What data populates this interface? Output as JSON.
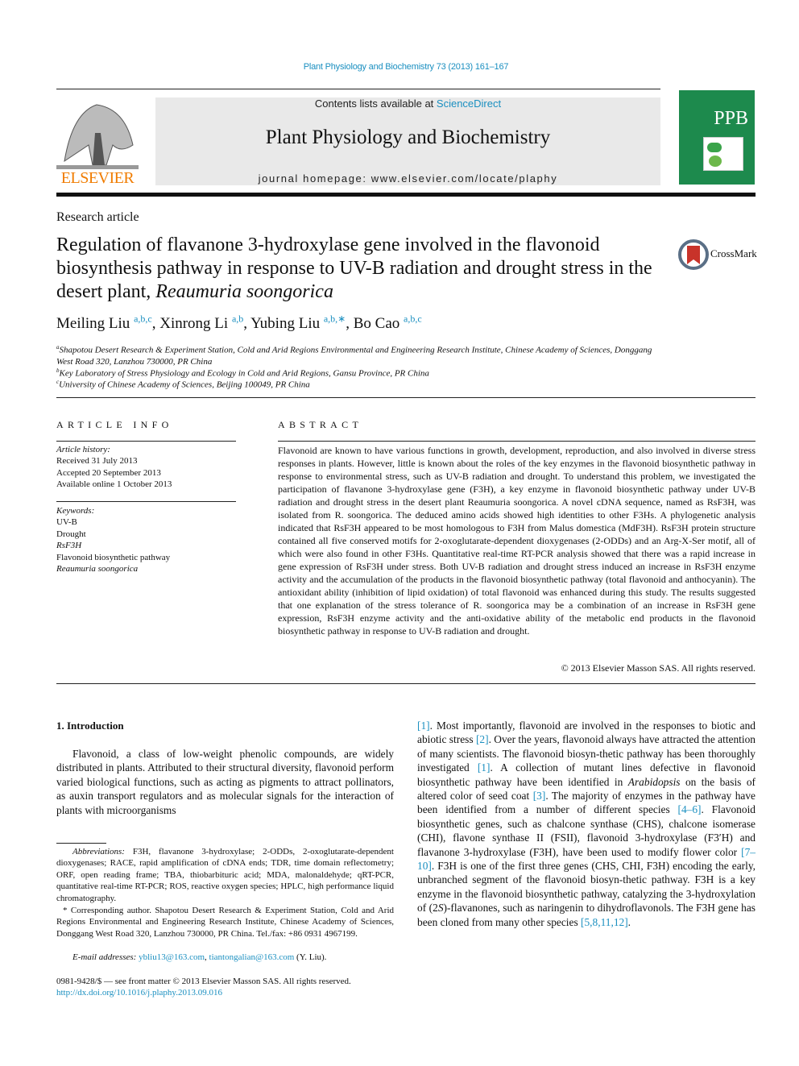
{
  "citation": "Plant Physiology and Biochemistry 73 (2013) 161–167",
  "masthead": {
    "publisher_logo_text": "ELSEVIER",
    "contents_prefix": "Contents lists available at ",
    "contents_link": "ScienceDirect",
    "journal_name": "Plant Physiology and Biochemistry",
    "homepage": "journal homepage: www.elsevier.com/locate/plaphy",
    "cover_abbrev": "PPB"
  },
  "article_type": "Research article",
  "title_main": "Regulation of flavanone 3-hydroxylase gene involved in the flavonoid biosynthesis pathway in response to UV-B radiation and drought stress in the desert plant, ",
  "title_species": "Reaumuria soongorica",
  "crossmark_label": "CrossMark",
  "authors": [
    {
      "name": "Meiling Liu",
      "affil": "a,b,c",
      "sep": ", "
    },
    {
      "name": "Xinrong Li",
      "affil": "a,b",
      "sep": ", "
    },
    {
      "name": "Yubing Liu",
      "affil": "a,b,∗",
      "sep": ", "
    },
    {
      "name": "Bo Cao",
      "affil": "a,b,c",
      "sep": ""
    }
  ],
  "affiliations": [
    {
      "mark": "a",
      "text": "Shapotou Desert Research & Experiment Station, Cold and Arid Regions Environmental and Engineering Research Institute, Chinese Academy of Sciences, Donggang West Road 320, Lanzhou 730000, PR China"
    },
    {
      "mark": "b",
      "text": "Key Laboratory of Stress Physiology and Ecology in Cold and Arid Regions, Gansu Province, PR China"
    },
    {
      "mark": "c",
      "text": "University of Chinese Academy of Sciences, Beijing 100049, PR China"
    }
  ],
  "article_info": {
    "heading": "ARTICLE INFO",
    "history_label": "Article history:",
    "received": "Received 31 July 2013",
    "accepted": "Accepted 20 September 2013",
    "online": "Available online 1 October 2013",
    "keywords_label": "Keywords:",
    "keywords": [
      "UV-B",
      "Drought",
      "RsF3H",
      "Flavonoid biosynthetic pathway",
      "Reaumuria soongorica"
    ]
  },
  "abstract": {
    "heading": "ABSTRACT",
    "text": "Flavonoid are known to have various functions in growth, development, reproduction, and also involved in diverse stress responses in plants. However, little is known about the roles of the key enzymes in the flavonoid biosynthetic pathway in response to environmental stress, such as UV-B radiation and drought. To understand this problem, we investigated the participation of flavanone 3-hydroxylase gene (F3H), a key enzyme in flavonoid biosynthetic pathway under UV-B radiation and drought stress in the desert plant Reaumuria soongorica. A novel cDNA sequence, named as RsF3H, was isolated from R. soongorica. The deduced amino acids showed high identities to other F3Hs. A phylogenetic analysis indicated that RsF3H appeared to be most homologous to F3H from Malus domestica (MdF3H). RsF3H protein structure contained all five conserved motifs for 2-oxoglutarate-dependent dioxygenases (2-ODDs) and an Arg-X-Ser motif, all of which were also found in other F3Hs. Quantitative real-time RT-PCR analysis showed that there was a rapid increase in gene expression of RsF3H under stress. Both UV-B radiation and drought stress induced an increase in RsF3H enzyme activity and the accumulation of the products in the flavonoid biosynthetic pathway (total flavonoid and anthocyanin). The antioxidant ability (inhibition of lipid oxidation) of total flavonoid was enhanced during this study. The results suggested that one explanation of the stress tolerance of R. soongorica may be a combination of an increase in RsF3H gene expression, RsF3H enzyme activity and the anti-oxidative ability of the metabolic end products in the flavonoid biosynthetic pathway in response to UV-B radiation and drought.",
    "copyright": "© 2013 Elsevier Masson SAS. All rights reserved."
  },
  "introduction": {
    "heading": "1.  Introduction",
    "left_text": "Flavonoid, a class of low-weight phenolic compounds, are widely distributed in plants. Attributed to their structural diversity, flavonoid perform varied biological functions, such as acting as pigments to attract pollinators, as auxin transport regulators and as molecular signals for the interaction of plants with microorganisms",
    "right_segments": [
      {
        "t": "[1]",
        "ref": true
      },
      {
        "t": ". Most importantly, flavonoid are involved in the responses to biotic and abiotic stress "
      },
      {
        "t": "[2]",
        "ref": true
      },
      {
        "t": ". Over the years, flavonoid always have attracted the attention of many scientists. The flavonoid biosyn-thetic pathway has been thoroughly investigated "
      },
      {
        "t": "[1]",
        "ref": true
      },
      {
        "t": ". A collection of mutant lines defective in flavonoid biosynthetic pathway have been identified in "
      },
      {
        "t": "Arabidopsis",
        "it": true
      },
      {
        "t": " on the basis of altered color of seed coat "
      },
      {
        "t": "[3]",
        "ref": true
      },
      {
        "t": ". The majority of enzymes in the pathway have been identified from a number of different species "
      },
      {
        "t": "[4–6]",
        "ref": true
      },
      {
        "t": ". Flavonoid biosynthetic genes, such as chalcone synthase (CHS), chalcone isomerase (CHI), flavone synthase II (FSII), flavonoid 3-hydroxylase (F3′H) and flavanone 3-hydroxylase (F3H), have been used to modify flower color "
      },
      {
        "t": "[7–10]",
        "ref": true
      },
      {
        "t": ". F3H is one of the first three genes (CHS, CHI, F3H) encoding the early, unbranched segment of the flavonoid biosyn-thetic pathway. F3H is a key enzyme in the flavonoid biosynthetic pathway, catalyzing the 3-hydroxylation of (2"
      },
      {
        "t": "S",
        "it": true
      },
      {
        "t": ")-flavanones, such as naringenin to dihydroflavonols. The F3H gene has been cloned from many other species "
      },
      {
        "t": "[5,8,11,12]",
        "ref": true
      },
      {
        "t": "."
      }
    ]
  },
  "footnotes": {
    "abbrev_label": "Abbreviations:",
    "abbrev_text": " F3H, flavanone 3-hydroxylase; 2-ODDs, 2-oxoglutarate-dependent dioxygenases; RACE, rapid amplification of cDNA ends; TDR, time domain reflectometry; ORF, open reading frame; TBA, thiobarbituric acid; MDA, malonaldehyde; qRT-PCR, quantitative real-time RT-PCR; ROS, reactive oxygen species; HPLC, high performance liquid chromatography.",
    "corresponding": "* Corresponding author. Shapotou Desert Research & Experiment Station, Cold and Arid Regions Environmental and Engineering Research Institute, Chinese Academy of Sciences, Donggang West Road 320, Lanzhou 730000, PR China. Tel./fax: +86 0931 4967199.",
    "email_label": "E-mail addresses:",
    "email_1": "ybliu13@163.com",
    "email_2": "tiantongalian@163.com",
    "email_suffix": " (Y. Liu)."
  },
  "issn_line": "0981-9428/$ — see front matter © 2013 Elsevier Masson SAS. All rights reserved.",
  "doi": "http://dx.doi.org/10.1016/j.plaphy.2013.09.016"
}
